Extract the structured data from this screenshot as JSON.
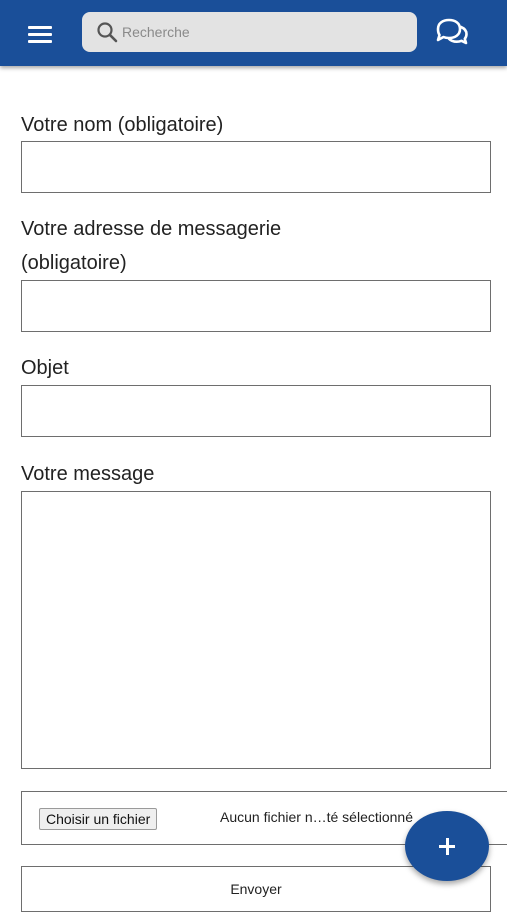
{
  "header": {
    "search_placeholder": "Recherche",
    "accent_color": "#1a4f99",
    "menu_icon": "hamburger-menu-icon",
    "search_icon": "search-icon",
    "chat_icon": "chat-bubbles-icon"
  },
  "form": {
    "name_label": "Votre nom (obligatoire)",
    "name_value": "",
    "email_label_line1": "Votre adresse de messagerie",
    "email_label_line2": "(obligatoire)",
    "email_value": "",
    "subject_label": "Objet",
    "subject_value": "",
    "message_label": "Votre message",
    "message_value": "",
    "file_button_label": "Choisir un fichier",
    "file_status": "Aucun fichier n…té sélectionné",
    "submit_label": "Envoyer"
  },
  "fab": {
    "icon": "plus-icon"
  }
}
